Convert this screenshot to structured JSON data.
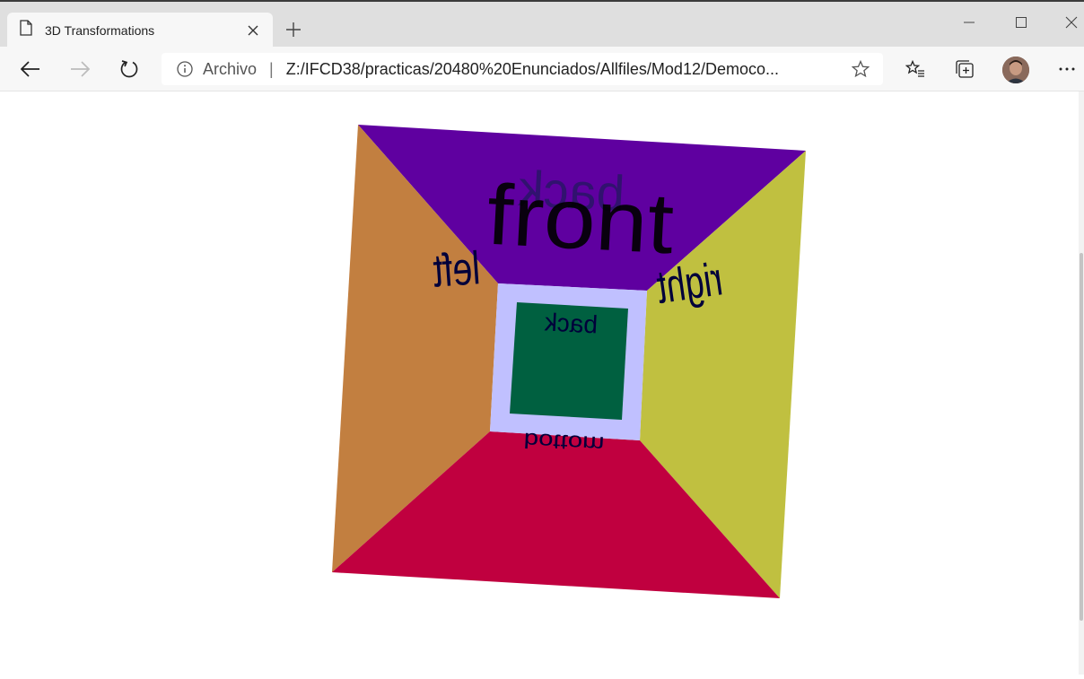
{
  "tab": {
    "title": "3D Transformations",
    "icon": "page-icon"
  },
  "window_controls": [
    "minimize-icon",
    "maximize-icon",
    "close-icon"
  ],
  "address_bar": {
    "scheme_label": "Archivo",
    "separator": "|",
    "url": "Z:/IFCD38/practicas/20480%20Enunciados/Allfiles/Mod12/Democo..."
  },
  "toolbar": {
    "more_label": "···"
  },
  "cube": {
    "faces": {
      "top": {
        "label": "front",
        "color": "#5f00a0"
      },
      "left": {
        "label": "left",
        "color": "#c27f40"
      },
      "right": {
        "label": "right",
        "color": "#c0c040"
      },
      "bottom": {
        "label": "bottom",
        "color": "#c0003f"
      },
      "back": {
        "label": "back",
        "color": "#006040"
      },
      "back_frame_color": "#c0c0ff"
    },
    "mirrored_top_label": "back",
    "label_color": "#00003a"
  }
}
